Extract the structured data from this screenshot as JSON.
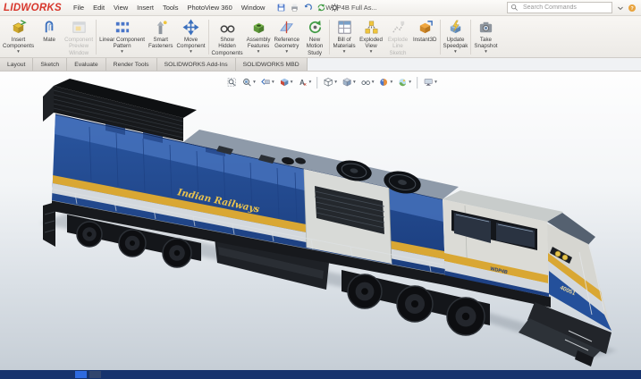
{
  "app": {
    "logo_text": "LIDWORKS",
    "title": "WDP4B Full As..."
  },
  "colors": {
    "accent_red": "#d8362b",
    "stripe_yellow": "#d9a733",
    "body_blue": "#2a56a0",
    "taskbar_bg": "#16336e"
  },
  "glyphs": {
    "dropdown_caret": "▾"
  },
  "menubar": {
    "menus": [
      {
        "label": "File"
      },
      {
        "label": "Edit"
      },
      {
        "label": "View"
      },
      {
        "label": "Insert"
      },
      {
        "label": "Tools"
      },
      {
        "label": "PhotoView 360"
      },
      {
        "label": "Window"
      }
    ],
    "quick_icons": [
      {
        "name": "save-icon"
      },
      {
        "name": "print-icon"
      },
      {
        "name": "undo-icon"
      },
      {
        "name": "rebuild-icon"
      },
      {
        "name": "options-icon"
      }
    ],
    "search": {
      "placeholder": "Search Commands",
      "icon": "search-icon"
    },
    "right_icons": [
      {
        "name": "chevron-down-icon"
      },
      {
        "name": "help-icon"
      }
    ]
  },
  "ribbon": {
    "items": [
      {
        "id": "insert-components",
        "label_lines": [
          "Insert",
          "Components"
        ],
        "icon": "insert-component-icon",
        "enabled": true,
        "dropdown": true
      },
      {
        "id": "mate",
        "label_lines": [
          "Mate"
        ],
        "icon": "mate-icon",
        "enabled": true,
        "dropdown": false
      },
      {
        "id": "component-preview-window",
        "label_lines": [
          "Component",
          "Preview",
          "Window"
        ],
        "icon": "component-preview-icon",
        "enabled": false,
        "dropdown": false,
        "sep_after": true
      },
      {
        "id": "linear-component-pattern",
        "label_lines": [
          "Linear Component",
          "Pattern"
        ],
        "icon": "linear-pattern-icon",
        "enabled": true,
        "dropdown": true
      },
      {
        "id": "smart-fasteners",
        "label_lines": [
          "Smart",
          "Fasteners"
        ],
        "icon": "smart-fasteners-icon",
        "enabled": true,
        "dropdown": false
      },
      {
        "id": "move-component",
        "label_lines": [
          "Move",
          "Component"
        ],
        "icon": "move-component-icon",
        "enabled": true,
        "dropdown": true,
        "sep_after": true
      },
      {
        "id": "show-hidden-components",
        "label_lines": [
          "Show",
          "Hidden",
          "Components"
        ],
        "icon": "show-hidden-icon",
        "enabled": true,
        "dropdown": false
      },
      {
        "id": "assembly-features",
        "label_lines": [
          "Assembly",
          "Features"
        ],
        "icon": "assembly-features-icon",
        "enabled": true,
        "dropdown": true
      },
      {
        "id": "reference-geometry",
        "label_lines": [
          "Reference",
          "Geometry"
        ],
        "icon": "reference-geometry-icon",
        "enabled": true,
        "dropdown": true
      },
      {
        "id": "new-motion-study",
        "label_lines": [
          "New",
          "Motion",
          "Study"
        ],
        "icon": "motion-study-icon",
        "enabled": true,
        "dropdown": false,
        "sep_after": true
      },
      {
        "id": "bill-of-materials",
        "label_lines": [
          "Bill of",
          "Materials"
        ],
        "icon": "bom-icon",
        "enabled": true,
        "dropdown": true
      },
      {
        "id": "exploded-view",
        "label_lines": [
          "Exploded",
          "View"
        ],
        "icon": "exploded-view-icon",
        "enabled": true,
        "dropdown": true
      },
      {
        "id": "explode-line-sketch",
        "label_lines": [
          "Explode",
          "Line",
          "Sketch"
        ],
        "icon": "explode-line-icon",
        "enabled": false,
        "dropdown": false
      },
      {
        "id": "instant3d",
        "label_lines": [
          "Instant3D"
        ],
        "icon": "instant3d-icon",
        "enabled": true,
        "dropdown": false,
        "sep_after": true
      },
      {
        "id": "update-speedpak",
        "label_lines": [
          "Update",
          "Speedpak"
        ],
        "icon": "speedpak-icon",
        "enabled": true,
        "dropdown": true,
        "sep_after": true
      },
      {
        "id": "take-snapshot",
        "label_lines": [
          "Take",
          "Snapshot"
        ],
        "icon": "snapshot-icon",
        "enabled": true,
        "dropdown": true
      }
    ]
  },
  "tabbar": {
    "tabs": [
      {
        "label": "Layout"
      },
      {
        "label": "Sketch"
      },
      {
        "label": "Evaluate"
      },
      {
        "label": "Render Tools"
      },
      {
        "label": "SOLIDWORKS Add-Ins"
      },
      {
        "label": "SOLIDWORKS MBD"
      }
    ]
  },
  "headsup": {
    "icons": [
      {
        "name": "zoom-fit-icon",
        "dropdown": false
      },
      {
        "name": "zoom-area-icon",
        "dropdown": true
      },
      {
        "name": "previous-view-icon",
        "dropdown": true
      },
      {
        "name": "section-view-icon",
        "dropdown": true
      },
      {
        "name": "annotation-views-icon",
        "dropdown": true,
        "sep_after": true
      },
      {
        "name": "view-orientation-icon",
        "dropdown": true
      },
      {
        "name": "display-style-icon",
        "dropdown": true
      },
      {
        "name": "hide-show-items-icon",
        "dropdown": true
      },
      {
        "name": "edit-appearance-icon",
        "dropdown": true
      },
      {
        "name": "apply-scene-icon",
        "dropdown": true,
        "sep_after": true
      },
      {
        "name": "view-settings-icon",
        "dropdown": true
      }
    ]
  },
  "viewport": {
    "model": {
      "side_text": "Indian Railways",
      "road_number": "40051",
      "class_text": "WDP4B"
    }
  },
  "taskbar": {
    "icons": [
      {
        "name": "taskbar-app-blue-icon"
      },
      {
        "name": "taskbar-app-icon"
      }
    ]
  }
}
